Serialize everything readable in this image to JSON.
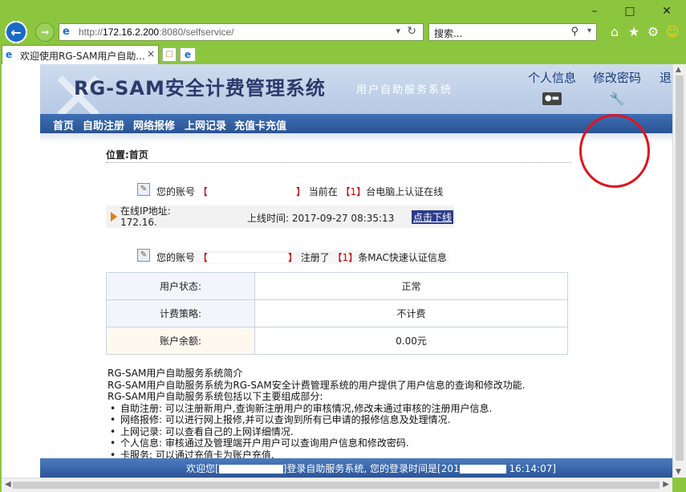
{
  "browser": {
    "url_prefix": "http://",
    "url_host": "172.16.2.200",
    "url_rest": ":8080/selfservice/",
    "search_placeholder": "搜索...",
    "tab_title": "欢迎使用RG-SAM用户自助..."
  },
  "header": {
    "brand": "RG-SAM安全计费管理系统",
    "subtitle": "用户自助服务系统",
    "nav": [
      {
        "label": "个人信息",
        "icon": "id-card-icon"
      },
      {
        "label": "修改密码",
        "icon": "wrench-icon"
      },
      {
        "label": "退"
      }
    ]
  },
  "menu": [
    "首页",
    "自助注册",
    "网络报修",
    "上网记录",
    "充值卡充值"
  ],
  "breadcrumb": "位置:首页",
  "online": {
    "prefix": "您的账号",
    "bracket_open": "【",
    "bracket_close": "】",
    "middle": "当前在",
    "count": "【1】",
    "suffix": "台电脑上认证在线",
    "ip_label": "在线IP地址:",
    "ip_value": "172.16.",
    "time_label": "上线时间:",
    "time_value": "2017-09-27 08:35:13",
    "offline_link": "点击下线"
  },
  "mac": {
    "prefix": "您的账号",
    "bracket_open": "【",
    "bracket_close": "】",
    "middle": "注册了",
    "count": "【1】",
    "suffix": "条MAC快速认证信息"
  },
  "table": [
    {
      "label": "用户状态:",
      "value": "正常"
    },
    {
      "label": "计费策略:",
      "value": "不计费"
    },
    {
      "label": "账户余额:",
      "value": "0.00元"
    }
  ],
  "intro": {
    "title": "RG-SAM用户自助服务系统简介",
    "line1": "RG-SAM用户自助服务系统为RG-SAM安全计费管理系统的用户提供了用户信息的查询和修改功能.",
    "line2": "RG-SAM用户自助服务系统包括以下主要组成部分:",
    "items": [
      "自助注册: 可以注册新用户,查询新注册用户的审核情况,修改未通过审核的注册用户信息.",
      "网络报修: 可以进行网上报修,并可以查询到所有已申请的报修信息及处理情况.",
      "上网记录: 可以查看自己的上网详细情况.",
      "个人信息: 审核通过及管理端开户用户可以查询用户信息和修改密码.",
      "卡服务: 可以通过充值卡为账户充值."
    ]
  },
  "footer": {
    "welcome": "欢迎您",
    "bracket_open": "[",
    "bracket_close": "]",
    "middle": "登录自助服务系统, 您的登录时间是",
    "time_prefix": "[201",
    "time_suffix": "16:14:07]"
  },
  "colors": {
    "chrome": "#8cc63f",
    "header_nav_text": "#1a3c7a",
    "menu_bar": "#2a5394",
    "accent_red": "#cc0000",
    "annotation_circle": "#e0141e"
  }
}
